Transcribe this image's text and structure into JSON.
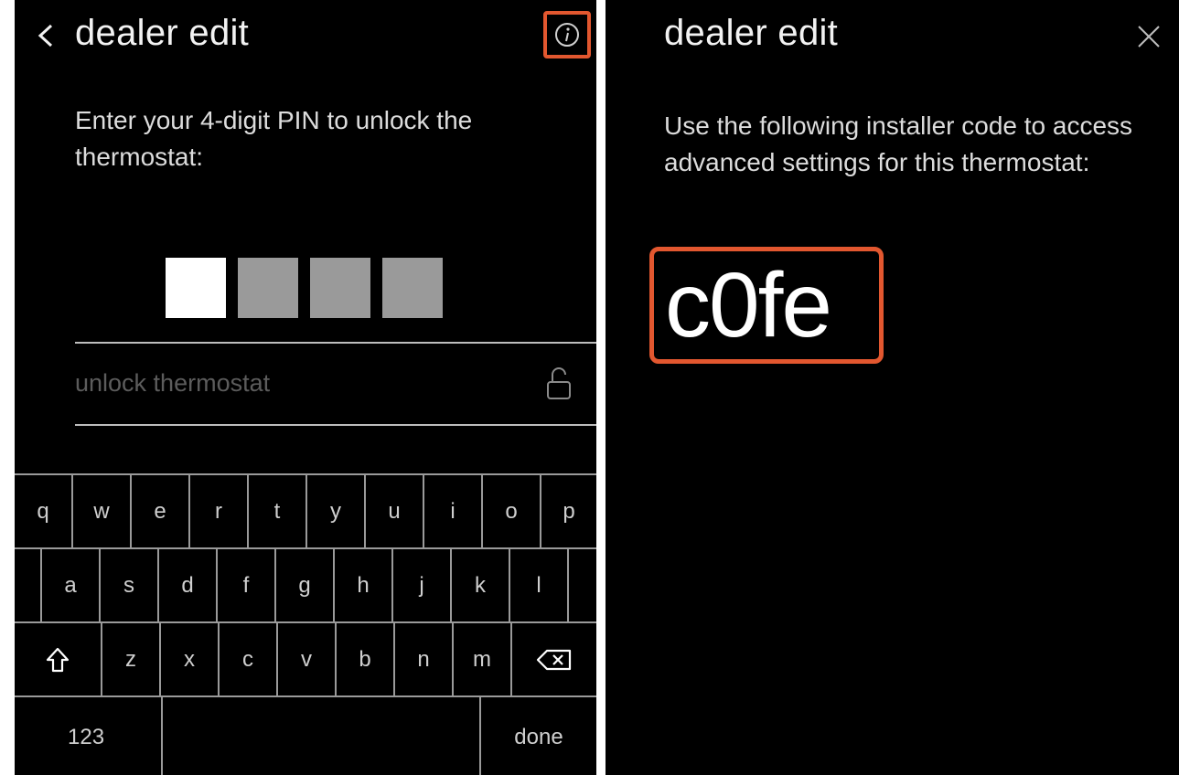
{
  "left_screen": {
    "title": "dealer edit",
    "prompt": "Enter your 4-digit PIN to unlock the thermostat:",
    "pin_boxes": [
      {
        "state": "active"
      },
      {
        "state": "empty"
      },
      {
        "state": "empty"
      },
      {
        "state": "empty"
      }
    ],
    "unlock_placeholder": "unlock thermostat",
    "icons": {
      "back": "chevron-left-icon",
      "info": "info-icon",
      "lock": "unlock-icon"
    },
    "highlight_color": "#e2572f"
  },
  "keyboard": {
    "row1": [
      "q",
      "w",
      "e",
      "r",
      "t",
      "y",
      "u",
      "i",
      "o",
      "p"
    ],
    "row2": [
      "a",
      "s",
      "d",
      "f",
      "g",
      "h",
      "j",
      "k",
      "l"
    ],
    "row3": [
      "z",
      "x",
      "c",
      "v",
      "b",
      "n",
      "m"
    ],
    "numbers_label": "123",
    "done_label": "done",
    "icons": {
      "shift": "shift-icon",
      "backspace": "backspace-icon"
    }
  },
  "right_screen": {
    "title": "dealer edit",
    "prompt": "Use the following installer code to access advanced settings for this thermostat:",
    "installer_code": "c0fe",
    "icons": {
      "close": "close-icon"
    },
    "highlight_color": "#e2572f"
  }
}
